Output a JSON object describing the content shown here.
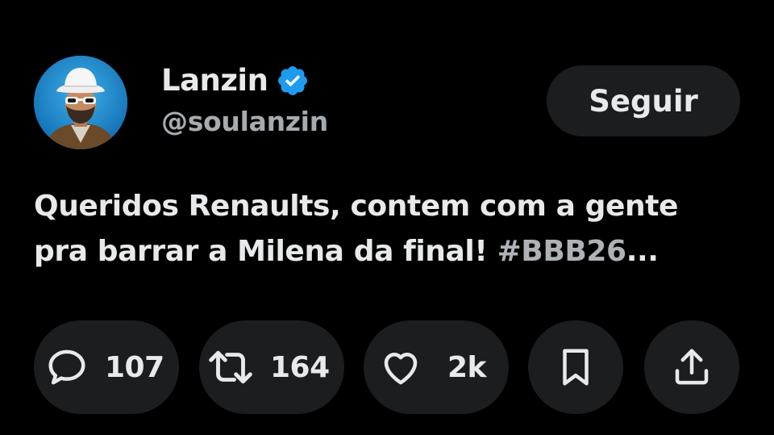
{
  "tweet": {
    "author": {
      "display_name": "Lanzin",
      "handle": "@soulanzin",
      "verified": true
    },
    "follow_label": "Seguir",
    "text_line_1": "Queridos Renaults, contem com a gente",
    "text_line_2": "pra barrar a Milena da final! ",
    "hashtag": "#BBB26",
    "ellipsis": "...",
    "actions": {
      "replies": "107",
      "retweets": "164",
      "likes": "2k"
    }
  },
  "icons": {
    "verified": "verified-badge-icon",
    "reply": "reply-icon",
    "retweet": "retweet-icon",
    "like": "heart-icon",
    "bookmark": "bookmark-icon",
    "share": "share-icon"
  },
  "colors": {
    "background": "#000000",
    "text": "#e7e9ea",
    "secondary_text": "#a6abb0",
    "button_background": "#1c1d1f",
    "verified_blue": "#1d9bf0"
  }
}
